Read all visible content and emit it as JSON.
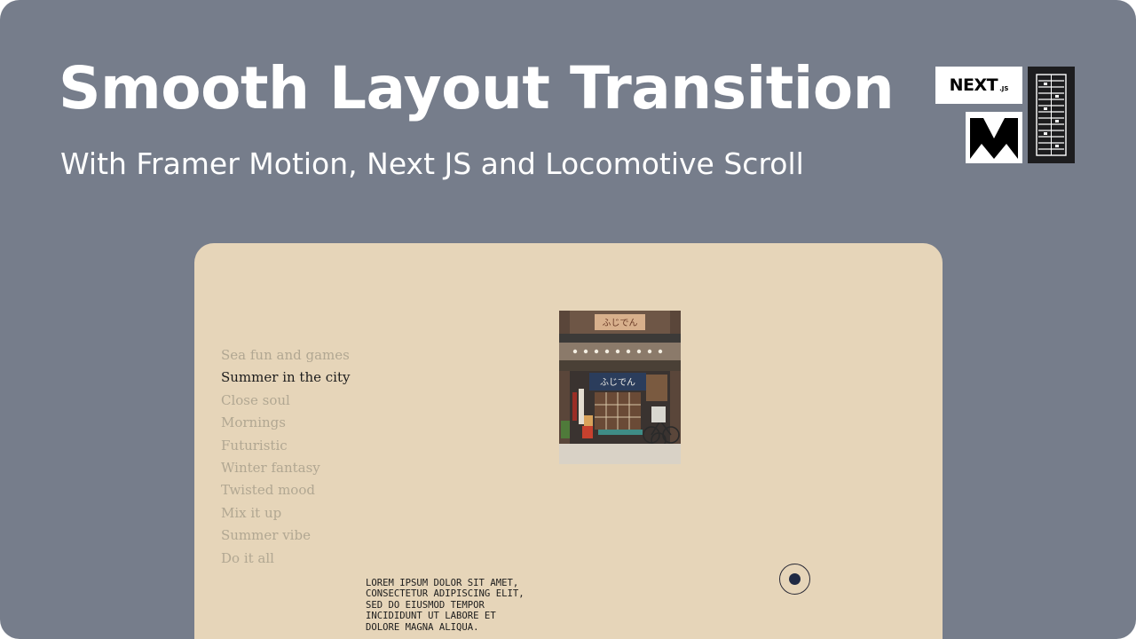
{
  "header": {
    "title": "Smooth Layout Transition",
    "subtitle": "With Framer Motion, Next JS and Locomotive Scroll"
  },
  "logos": {
    "next_word": "NEXT",
    "next_sub": ".JS",
    "framer": "framer-motion-logo",
    "locomotive": "locomotive-scroll-logo"
  },
  "menu": {
    "items": [
      {
        "label": "Sea fun and games",
        "active": false
      },
      {
        "label": "Summer in the city",
        "active": true
      },
      {
        "label": "Close soul",
        "active": false
      },
      {
        "label": "Mornings",
        "active": false
      },
      {
        "label": "Futuristic",
        "active": false
      },
      {
        "label": "Winter fantasy",
        "active": false
      },
      {
        "label": "Twisted mood",
        "active": false
      },
      {
        "label": "Mix it up",
        "active": false
      },
      {
        "label": "Summer vibe",
        "active": false
      },
      {
        "label": "Do it all",
        "active": false
      }
    ]
  },
  "photo": {
    "sign_top": "ふじでん",
    "sign_main": "ふじでん"
  },
  "lorem": "LOREM IPSUM DOLOR SIT AMET,\nCONSECTETUR ADIPISCING ELIT,\nSED DO EIUSMOD TEMPOR\nINCIDIDUNT UT LABORE ET\nDOLORE MAGNA ALIQUA.",
  "colors": {
    "background": "#767d8b",
    "card": "#e6d5b9",
    "menu_inactive": "#b1a792",
    "menu_active": "#1c1c1c"
  }
}
